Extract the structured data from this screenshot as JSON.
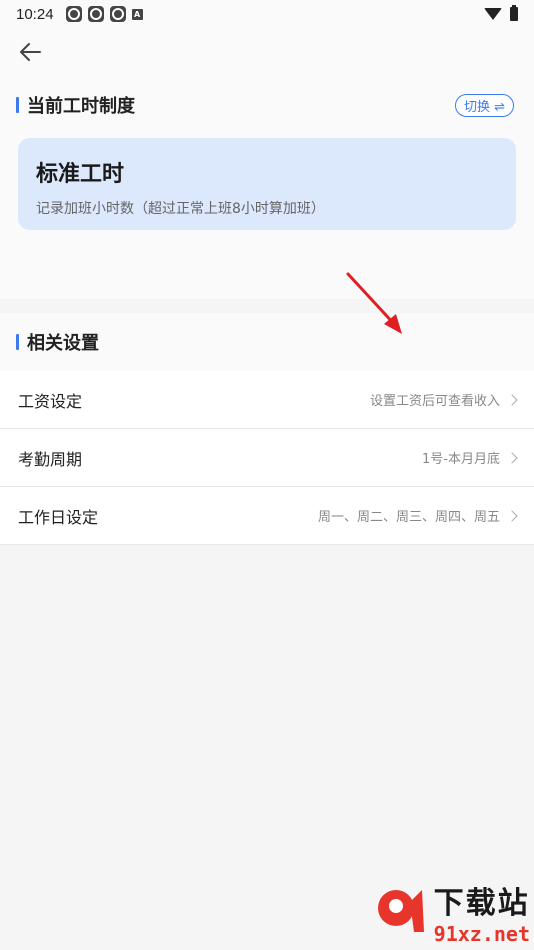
{
  "status": {
    "time": "10:24",
    "a_badge": "A"
  },
  "current": {
    "title": "当前工时制度",
    "switch_label": "切换 ⇌",
    "card_title": "标准工时",
    "card_desc": "记录加班小时数（超过正常上班8小时算加班）"
  },
  "settings": {
    "title": "相关设置",
    "rows": [
      {
        "label": "工资设定",
        "value": "设置工资后可查看收入"
      },
      {
        "label": "考勤周期",
        "value": "1号-本月月底"
      },
      {
        "label": "工作日设定",
        "value": "周一、周二、周三、周四、周五"
      }
    ]
  },
  "watermark": {
    "cn": "下载站",
    "url": "91xz.net"
  },
  "colors": {
    "accent": "#3a7cf0",
    "card_bg": "#dce8fb",
    "annotation_arrow": "#e02020"
  }
}
